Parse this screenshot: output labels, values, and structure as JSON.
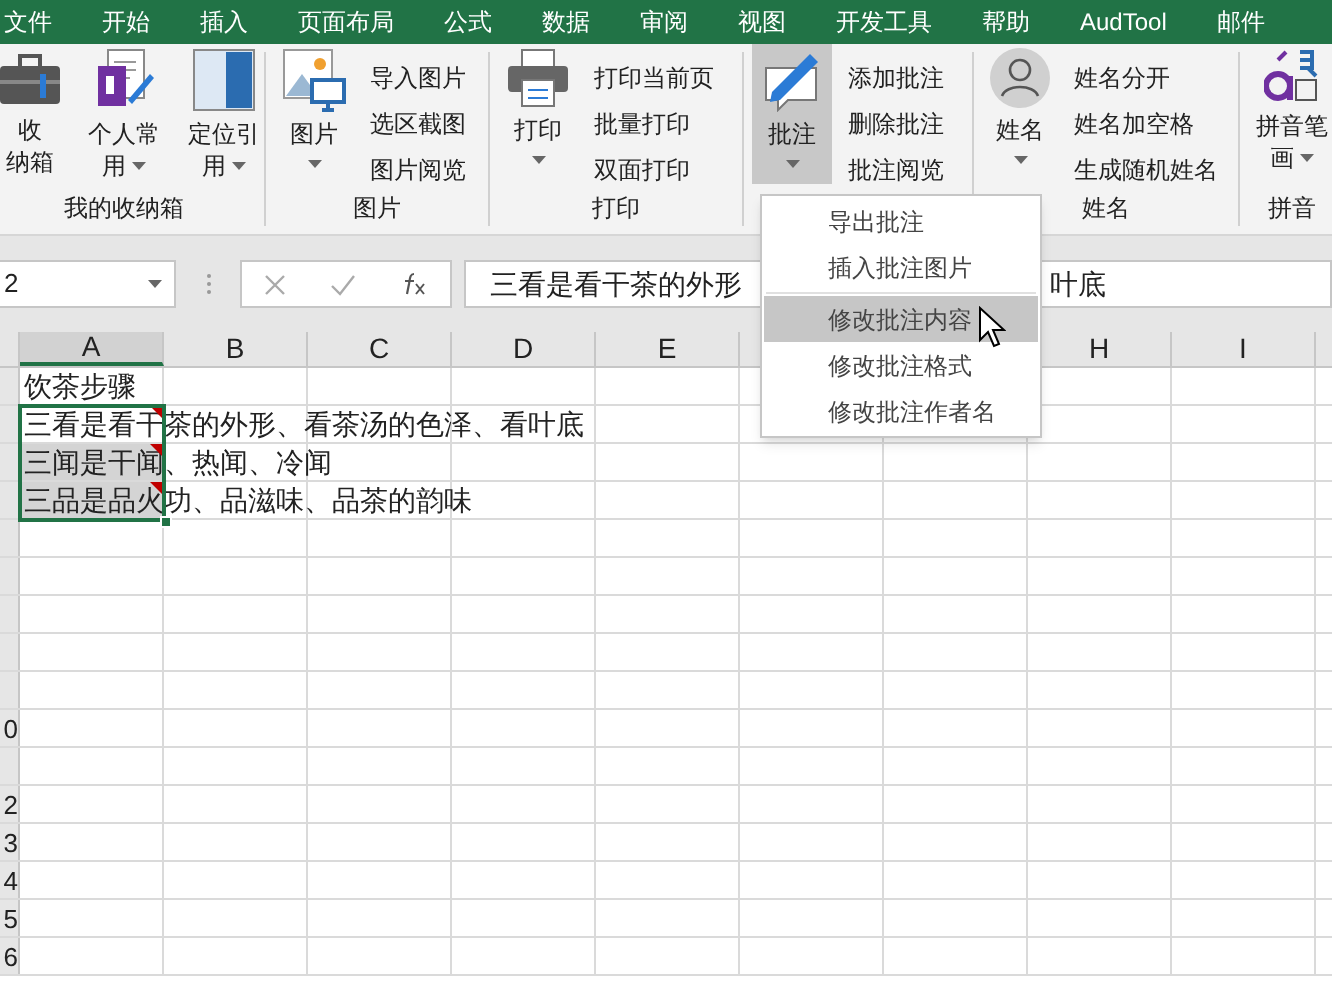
{
  "tabs": [
    {
      "label": "文件"
    },
    {
      "label": "开始"
    },
    {
      "label": "插入"
    },
    {
      "label": "页面布局"
    },
    {
      "label": "公式"
    },
    {
      "label": "数据"
    },
    {
      "label": "审阅"
    },
    {
      "label": "视图"
    },
    {
      "label": "开发工具"
    },
    {
      "label": "帮助"
    },
    {
      "label": "AudTool"
    },
    {
      "label": "邮件"
    }
  ],
  "ribbon": [
    {
      "label": "我的收纳箱",
      "large": [
        {
          "lines": [
            "收",
            "纳箱"
          ],
          "dropdown": false,
          "pressed": false
        },
        {
          "lines": [
            "个人常",
            "用"
          ],
          "dropdown": true,
          "pressed": false
        },
        {
          "lines": [
            "定位引",
            "用"
          ],
          "dropdown": true,
          "pressed": false
        }
      ]
    },
    {
      "label": "图片",
      "large": [
        {
          "lines": [
            "图片"
          ],
          "dropdown": true,
          "pressed": false
        }
      ],
      "small": [
        "导入图片",
        "选区截图",
        "图片阅览"
      ]
    },
    {
      "label": "打印",
      "large": [
        {
          "lines": [
            "打印"
          ],
          "dropdown": true,
          "pressed": false
        }
      ],
      "small": [
        "打印当前页",
        "批量打印",
        "双面打印"
      ]
    },
    {
      "large": [
        {
          "lines": [
            "批注"
          ],
          "dropdown": true,
          "pressed": true
        }
      ],
      "small": [
        "添加批注",
        "删除批注",
        "批注阅览"
      ]
    },
    {
      "label": "姓名",
      "large": [
        {
          "lines": [
            "姓名"
          ],
          "dropdown": true,
          "pressed": false
        }
      ],
      "small": [
        "姓名分开",
        "姓名加空格",
        "生成随机姓名"
      ]
    },
    {
      "label": "拼音",
      "large": [
        {
          "lines": [
            "拼音笔",
            "画"
          ],
          "dropdown": true,
          "pressed": false
        }
      ]
    }
  ],
  "name_box": "2",
  "formula_bar": {
    "visible_start": "三看是看干茶的外形",
    "visible_end": "叶底"
  },
  "columns": [
    {
      "label": "A",
      "selected": true
    },
    {
      "label": "B",
      "selected": false
    },
    {
      "label": "C",
      "selected": false
    },
    {
      "label": "D",
      "selected": false
    },
    {
      "label": "E",
      "selected": false
    },
    {},
    {},
    {
      "label": "H",
      "selected": false
    },
    {
      "label": "I",
      "selected": false
    }
  ],
  "rows": [
    {
      "cell_a": {
        "text": "饮茶步骤",
        "selected": false,
        "active": false,
        "comment": false
      }
    },
    {
      "cell_a": {
        "text": "三看是看干茶的外形、看茶汤的色泽、看叶底",
        "selected": true,
        "active": true,
        "comment": true
      }
    },
    {
      "cell_a": {
        "text": "三闻是干闻、热闻、冷闻",
        "selected": true,
        "active": false,
        "comment": true
      }
    },
    {
      "cell_a": {
        "text": "三品是品火功、品滋味、品茶的韵味",
        "selected": true,
        "active": false,
        "comment": true
      }
    },
    {},
    {},
    {},
    {},
    {},
    {
      "label": "0"
    },
    {},
    {
      "label": "2"
    },
    {
      "label": "3"
    },
    {
      "label": "4"
    },
    {
      "label": "5"
    },
    {
      "label": "6"
    }
  ],
  "menu": [
    {
      "kind": "item",
      "label": "导出批注",
      "selected": false
    },
    {
      "kind": "item",
      "label": "插入批注图片",
      "selected": false
    },
    {
      "kind": "separator"
    },
    {
      "kind": "item",
      "label": "修改批注内容",
      "selected": true
    },
    {
      "kind": "item",
      "label": "修改批注格式",
      "selected": false
    },
    {
      "kind": "item",
      "label": "修改批注作者名",
      "selected": false
    }
  ]
}
